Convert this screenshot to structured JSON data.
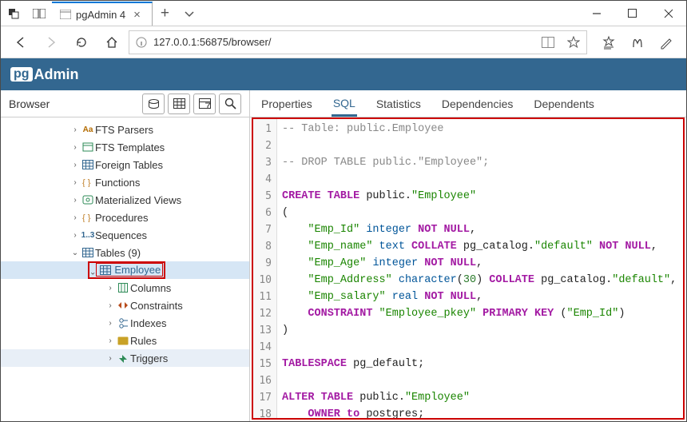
{
  "window": {
    "tab_title": "pgAdmin 4",
    "url": "127.0.0.1:56875/browser/"
  },
  "brand": {
    "pg": "pg",
    "admin": "Admin"
  },
  "sidebar": {
    "title": "Browser",
    "items": [
      {
        "label": "FTS Parsers",
        "indent": 86,
        "icon": "aa",
        "color": "#b36b00"
      },
      {
        "label": "FTS Templates",
        "indent": 86,
        "icon": "tpl",
        "color": "#2e8b57"
      },
      {
        "label": "Foreign Tables",
        "indent": 86,
        "icon": "ftbl",
        "color": "#336790"
      },
      {
        "label": "Functions",
        "indent": 86,
        "icon": "fn",
        "color": "#c0802a"
      },
      {
        "label": "Materialized Views",
        "indent": 86,
        "icon": "mv",
        "color": "#2e8b57"
      },
      {
        "label": "Procedures",
        "indent": 86,
        "icon": "proc",
        "color": "#c0802a"
      },
      {
        "label": "Sequences",
        "indent": 86,
        "icon": "seq",
        "color": "#336790"
      },
      {
        "label": "Tables (9)",
        "indent": 86,
        "icon": "tbl",
        "color": "#336790",
        "open": true
      },
      {
        "label": "Employee",
        "indent": 109,
        "icon": "tbl",
        "color": "#336790",
        "open": true,
        "selected": true
      },
      {
        "label": "Columns",
        "indent": 130,
        "icon": "cols",
        "color": "#2e8b57"
      },
      {
        "label": "Constraints",
        "indent": 130,
        "icon": "cons",
        "color": "#b84b1b"
      },
      {
        "label": "Indexes",
        "indent": 130,
        "icon": "idx",
        "color": "#336790"
      },
      {
        "label": "Rules",
        "indent": 130,
        "icon": "rule",
        "color": "#c9a227"
      },
      {
        "label": "Triggers",
        "indent": 130,
        "icon": "trig",
        "color": "#2e8b57",
        "hover": true
      }
    ]
  },
  "tabs": [
    "Properties",
    "SQL",
    "Statistics",
    "Dependencies",
    "Dependents"
  ],
  "active_tab": "SQL",
  "sql": {
    "lines": [
      [
        [
          "com",
          "-- Table: public.Employee"
        ]
      ],
      [],
      [
        [
          "com",
          "-- DROP TABLE public.\"Employee\";"
        ]
      ],
      [],
      [
        [
          "kw",
          "CREATE TABLE"
        ],
        [
          "id",
          " public."
        ],
        [
          "str",
          "\"Employee\""
        ]
      ],
      [
        [
          "id",
          "("
        ]
      ],
      [
        [
          "id",
          "    "
        ],
        [
          "str",
          "\"Emp_Id\""
        ],
        [
          "id",
          " "
        ],
        [
          "col",
          "integer"
        ],
        [
          "id",
          " "
        ],
        [
          "kw",
          "NOT NULL"
        ],
        [
          "id",
          ","
        ]
      ],
      [
        [
          "id",
          "    "
        ],
        [
          "str",
          "\"Emp_name\""
        ],
        [
          "id",
          " "
        ],
        [
          "col",
          "text"
        ],
        [
          "id",
          " "
        ],
        [
          "kw",
          "COLLATE"
        ],
        [
          "id",
          " pg_catalog."
        ],
        [
          "str",
          "\"default\""
        ],
        [
          "id",
          " "
        ],
        [
          "kw",
          "NOT NULL"
        ],
        [
          "id",
          ","
        ]
      ],
      [
        [
          "id",
          "    "
        ],
        [
          "str",
          "\"Emp_Age\""
        ],
        [
          "id",
          " "
        ],
        [
          "col",
          "integer"
        ],
        [
          "id",
          " "
        ],
        [
          "kw",
          "NOT NULL"
        ],
        [
          "id",
          ","
        ]
      ],
      [
        [
          "id",
          "    "
        ],
        [
          "str",
          "\"Emp_Address\""
        ],
        [
          "id",
          " "
        ],
        [
          "col",
          "character"
        ],
        [
          "id",
          "("
        ],
        [
          "num",
          "30"
        ],
        [
          "id",
          ") "
        ],
        [
          "kw",
          "COLLATE"
        ],
        [
          "id",
          " pg_catalog."
        ],
        [
          "str",
          "\"default\""
        ],
        [
          "id",
          ","
        ]
      ],
      [
        [
          "id",
          "    "
        ],
        [
          "str",
          "\"Emp_salary\""
        ],
        [
          "id",
          " "
        ],
        [
          "col",
          "real"
        ],
        [
          "id",
          " "
        ],
        [
          "kw",
          "NOT NULL"
        ],
        [
          "id",
          ","
        ]
      ],
      [
        [
          "id",
          "    "
        ],
        [
          "kw",
          "CONSTRAINT"
        ],
        [
          "id",
          " "
        ],
        [
          "str",
          "\"Employee_pkey\""
        ],
        [
          "id",
          " "
        ],
        [
          "kw",
          "PRIMARY KEY"
        ],
        [
          "id",
          " ("
        ],
        [
          "str",
          "\"Emp_Id\""
        ],
        [
          "id",
          ")"
        ]
      ],
      [
        [
          "id",
          ")"
        ]
      ],
      [],
      [
        [
          "kw",
          "TABLESPACE"
        ],
        [
          "id",
          " pg_default;"
        ]
      ],
      [],
      [
        [
          "kw",
          "ALTER TABLE"
        ],
        [
          "id",
          " public."
        ],
        [
          "str",
          "\"Employee\""
        ]
      ],
      [
        [
          "id",
          "    "
        ],
        [
          "kw",
          "OWNER to"
        ],
        [
          "id",
          " postgres;"
        ]
      ]
    ]
  }
}
